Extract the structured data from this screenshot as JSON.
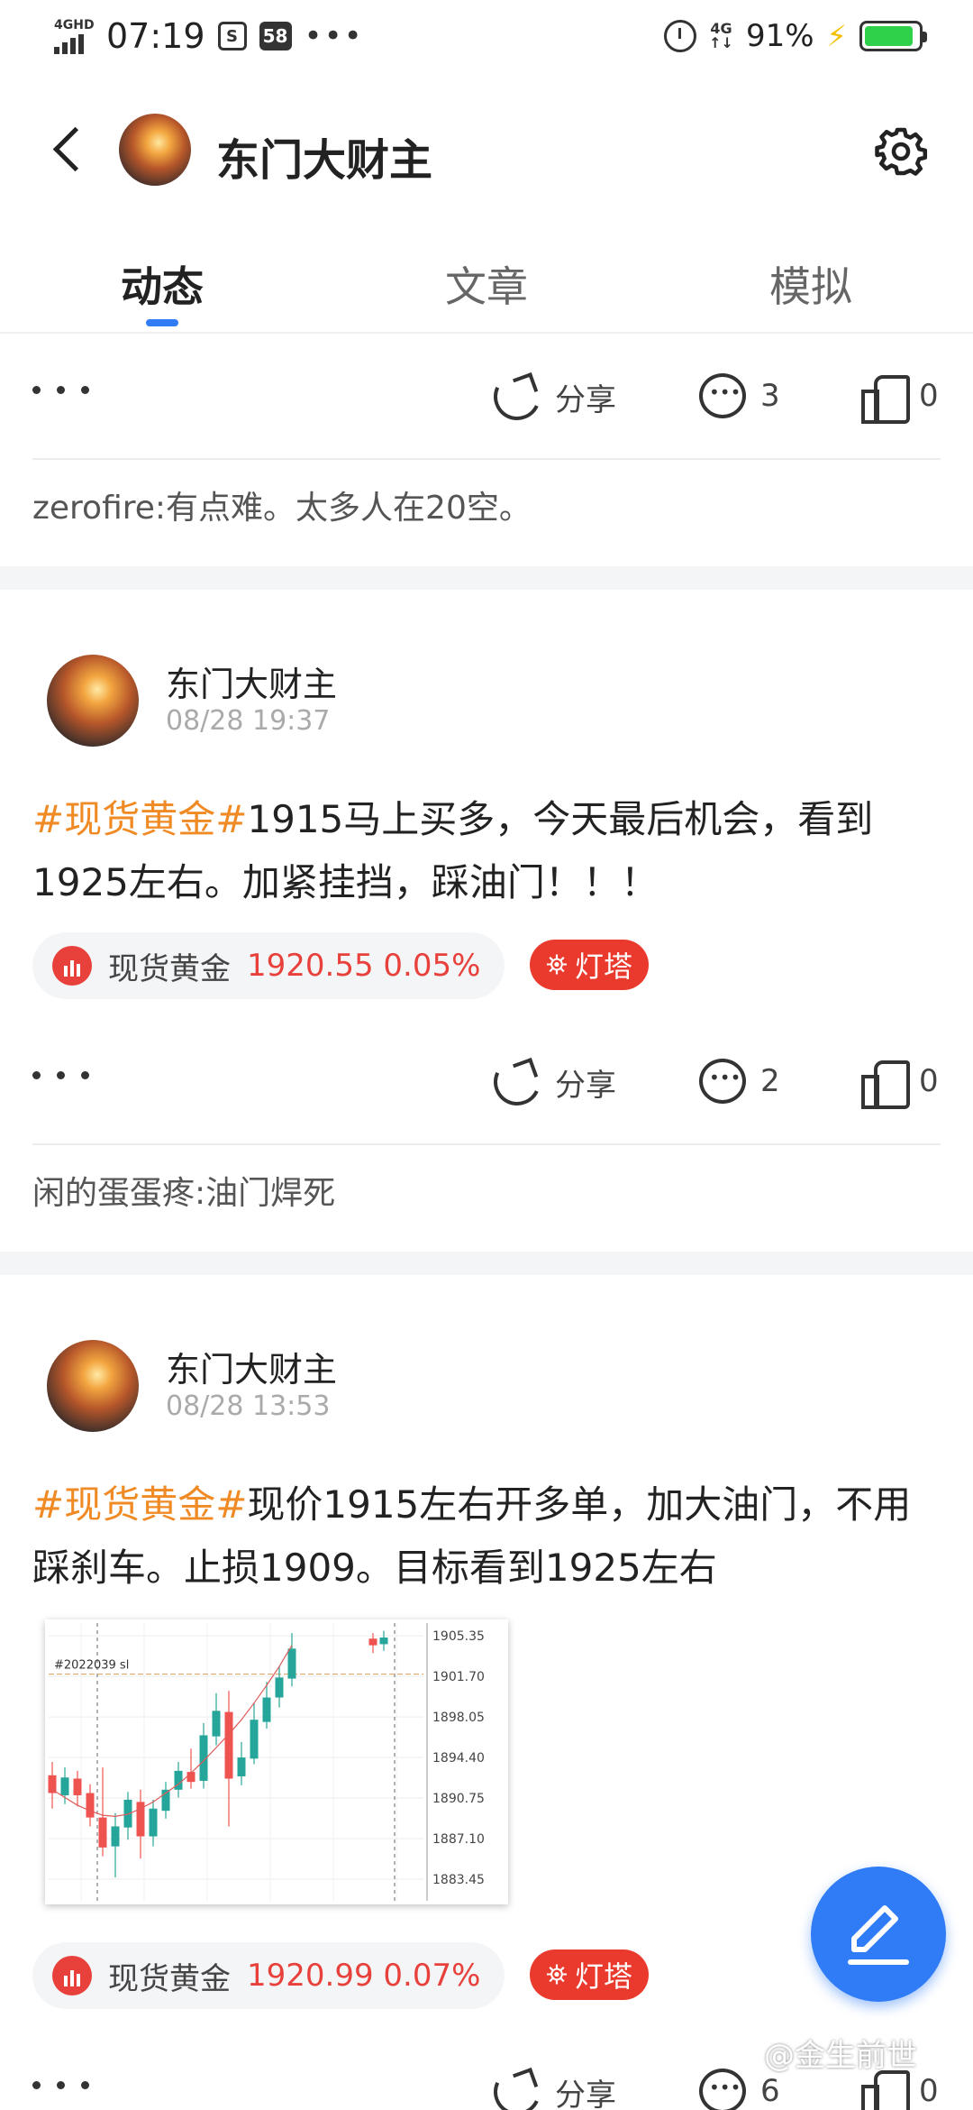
{
  "status_bar": {
    "network": "4GHD",
    "time": "07:19",
    "notif_badge": "58",
    "lte": "4G",
    "battery_percent": "91%",
    "battery_level": 0.91
  },
  "header": {
    "title": "东门大财主"
  },
  "tabs": [
    {
      "label": "动态",
      "active": true
    },
    {
      "label": "文章",
      "active": false
    },
    {
      "label": "模拟",
      "active": false
    }
  ],
  "top_actions": {
    "share_label": "分享",
    "comment_count": "3",
    "like_count": "0"
  },
  "top_comment": {
    "name": "zerofire",
    "text": ":有点难。太多人在20空。"
  },
  "posts": [
    {
      "author": "东门大财主",
      "time": "08/28 19:37",
      "tag": "#现货黄金#",
      "text": "1915马上买多，今天最后机会，看到1925左右。加紧挂挡，踩油门！！！",
      "stock_name": "现货黄金",
      "stock_value": "1920.55 0.05%",
      "lighthouse": "灯塔",
      "share_label": "分享",
      "comment_count": "2",
      "like_count": "0",
      "comment_name": "闲的蛋蛋疼",
      "comment_text": ":油门焊死"
    },
    {
      "author": "东门大财主",
      "time": "08/28 13:53",
      "tag": "#现货黄金#",
      "text": "现价1915左右开多单，加大油门，不用踩刹车。止损1909。目标看到1925左右",
      "stock_name": "现货黄金",
      "stock_value": "1920.99 0.07%",
      "lighthouse": "灯塔",
      "share_label": "分享",
      "comment_count": "6",
      "like_count": "0",
      "chart_label": "#2022039 sl",
      "chart_ticks": [
        "1905.35",
        "1901.70",
        "1898.05",
        "1894.40",
        "1890.75",
        "1887.10",
        "1883.45"
      ]
    }
  ],
  "watermark": "@金生前世",
  "colors": {
    "accent": "#2f7cf6",
    "tag": "#f08a24",
    "price_red": "#e8403a",
    "lighthouse": "#ea3a2e"
  },
  "chart_data": {
    "type": "candlestick",
    "title": "",
    "label": "#2022039 sl",
    "y_ticks": [
      1905.35,
      1901.7,
      1898.05,
      1894.4,
      1890.75,
      1887.1,
      1883.45
    ],
    "ylim": [
      1881.5,
      1906.5
    ],
    "candles": [
      {
        "o": 1892.8,
        "c": 1891.2,
        "h": 1894.0,
        "l": 1889.8
      },
      {
        "o": 1891.0,
        "c": 1892.6,
        "h": 1893.5,
        "l": 1890.2
      },
      {
        "o": 1892.5,
        "c": 1891.0,
        "h": 1893.2,
        "l": 1890.0
      },
      {
        "o": 1891.2,
        "c": 1889.0,
        "h": 1892.0,
        "l": 1888.2
      },
      {
        "o": 1889.0,
        "c": 1886.3,
        "h": 1893.5,
        "l": 1885.5
      },
      {
        "o": 1886.4,
        "c": 1888.2,
        "h": 1889.4,
        "l": 1883.6
      },
      {
        "o": 1888.1,
        "c": 1890.6,
        "h": 1891.3,
        "l": 1887.0
      },
      {
        "o": 1890.4,
        "c": 1887.3,
        "h": 1891.5,
        "l": 1885.3
      },
      {
        "o": 1887.3,
        "c": 1889.8,
        "h": 1890.6,
        "l": 1886.4
      },
      {
        "o": 1889.6,
        "c": 1891.5,
        "h": 1892.2,
        "l": 1888.9
      },
      {
        "o": 1891.5,
        "c": 1893.2,
        "h": 1894.0,
        "l": 1890.8
      },
      {
        "o": 1893.1,
        "c": 1892.2,
        "h": 1895.2,
        "l": 1891.6
      },
      {
        "o": 1892.3,
        "c": 1896.4,
        "h": 1897.5,
        "l": 1891.6
      },
      {
        "o": 1896.3,
        "c": 1898.6,
        "h": 1900.2,
        "l": 1895.5
      },
      {
        "o": 1898.5,
        "c": 1892.5,
        "h": 1900.4,
        "l": 1888.2
      },
      {
        "o": 1892.7,
        "c": 1894.4,
        "h": 1895.8,
        "l": 1891.9
      },
      {
        "o": 1894.3,
        "c": 1897.8,
        "h": 1899.3,
        "l": 1893.8
      },
      {
        "o": 1897.6,
        "c": 1899.8,
        "h": 1901.2,
        "l": 1897.0
      },
      {
        "o": 1899.8,
        "c": 1901.6,
        "h": 1902.6,
        "l": 1898.9
      },
      {
        "o": 1901.5,
        "c": 1904.2,
        "h": 1905.6,
        "l": 1900.8
      }
    ],
    "right_candles": [
      {
        "o": 1905.1,
        "c": 1904.5,
        "h": 1905.6,
        "l": 1903.8
      },
      {
        "o": 1904.6,
        "c": 1905.2,
        "h": 1905.8,
        "l": 1904.0
      }
    ],
    "ma": [
      1891.5,
      1890.8,
      1890.1,
      1889.6,
      1889.2,
      1889.1,
      1889.3,
      1889.8,
      1890.4,
      1891.2,
      1892.0,
      1893.0,
      1894.1,
      1895.3,
      1896.5,
      1897.8,
      1899.3,
      1900.9,
      1902.6,
      1904.5
    ],
    "grid": true
  }
}
